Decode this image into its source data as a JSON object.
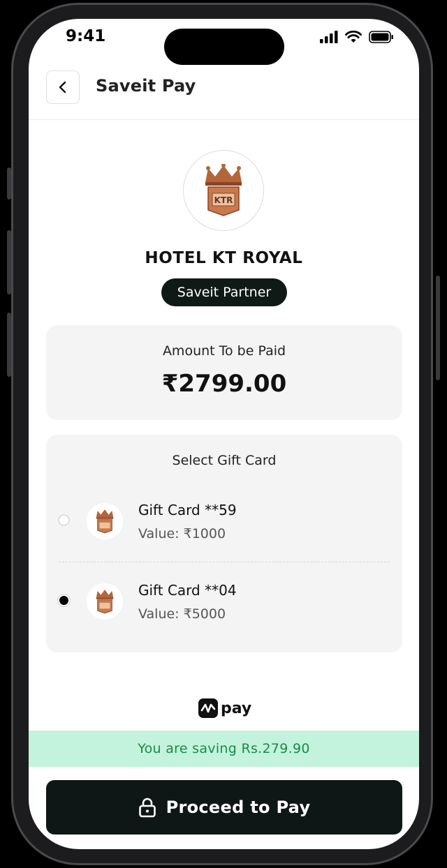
{
  "status_bar": {
    "time": "9:41"
  },
  "header": {
    "title": "Saveit Pay"
  },
  "merchant": {
    "name": "HOTEL KT ROYAL",
    "badge": "Saveit Partner",
    "logo_text": "KTR"
  },
  "amount": {
    "label": "Amount To be Paid",
    "value": "₹2799.00"
  },
  "gift_cards": {
    "title": "Select Gift Card",
    "items": [
      {
        "name": "Gift Card **59",
        "value": "Value: ₹1000",
        "selected": false
      },
      {
        "name": "Gift Card **04",
        "value": "Value: ₹5000",
        "selected": true
      }
    ]
  },
  "pay_brand": {
    "label": "pay"
  },
  "savings": {
    "text": "You are saving Rs.279.90"
  },
  "cta": {
    "label": "Proceed to Pay"
  },
  "colors": {
    "dark": "#0f1716",
    "savings_bg": "#c3f3dc",
    "savings_text": "#1a8a4a",
    "card_bg": "#f4f4f4",
    "logo_brown": "#b5653a"
  }
}
